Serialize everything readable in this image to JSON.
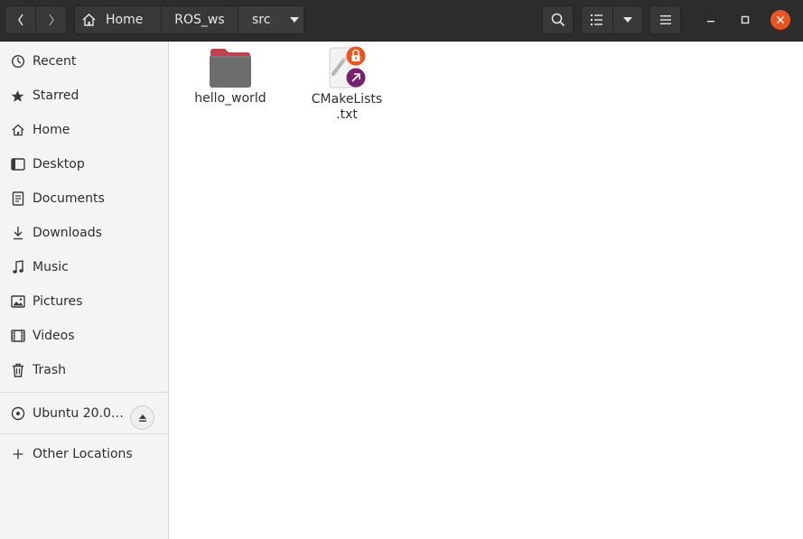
{
  "toolbar": {
    "back_icon": "chevron-left-icon",
    "forward_icon": "chevron-right-icon",
    "search_icon": "search-icon",
    "view_icon": "list-view-icon",
    "view_options_icon": "chevron-down-icon",
    "menu_icon": "hamburger-menu-icon"
  },
  "breadcrumb": {
    "home_label": "Home",
    "items": [
      "ROS_ws",
      "src"
    ]
  },
  "window_controls": {
    "minimize": "minimize-icon",
    "maximize": "maximize-icon",
    "close": "close-icon",
    "close_color": "#e95420"
  },
  "sidebar": {
    "items": [
      {
        "label": "Recent",
        "icon": "clock-icon"
      },
      {
        "label": "Starred",
        "icon": "star-icon"
      },
      {
        "label": "Home",
        "icon": "home-icon"
      },
      {
        "label": "Desktop",
        "icon": "desktop-icon"
      },
      {
        "label": "Documents",
        "icon": "document-icon"
      },
      {
        "label": "Downloads",
        "icon": "download-icon"
      },
      {
        "label": "Music",
        "icon": "music-icon"
      },
      {
        "label": "Pictures",
        "icon": "picture-icon"
      },
      {
        "label": "Videos",
        "icon": "video-icon"
      },
      {
        "label": "Trash",
        "icon": "trash-icon"
      }
    ],
    "device": {
      "label": "Ubuntu 20.0…",
      "icon": "disc-icon",
      "eject_icon": "eject-icon"
    },
    "other_locations": {
      "label": "Other Locations",
      "icon": "plus-icon"
    }
  },
  "files": [
    {
      "name": "hello_world",
      "type": "folder",
      "icon": "folder-icon"
    },
    {
      "name_lines": [
        "CMakeLists",
        ".txt"
      ],
      "type": "text-symlink",
      "icon": "text-file-icon",
      "badges": [
        "lock-icon",
        "symlink-icon"
      ]
    }
  ],
  "colors": {
    "header_bg": "#2c2c2c",
    "accent": "#e95420",
    "folder": "#6d6d6d",
    "folder_tab": "#c3404d",
    "symlink_badge": "#77216f"
  }
}
